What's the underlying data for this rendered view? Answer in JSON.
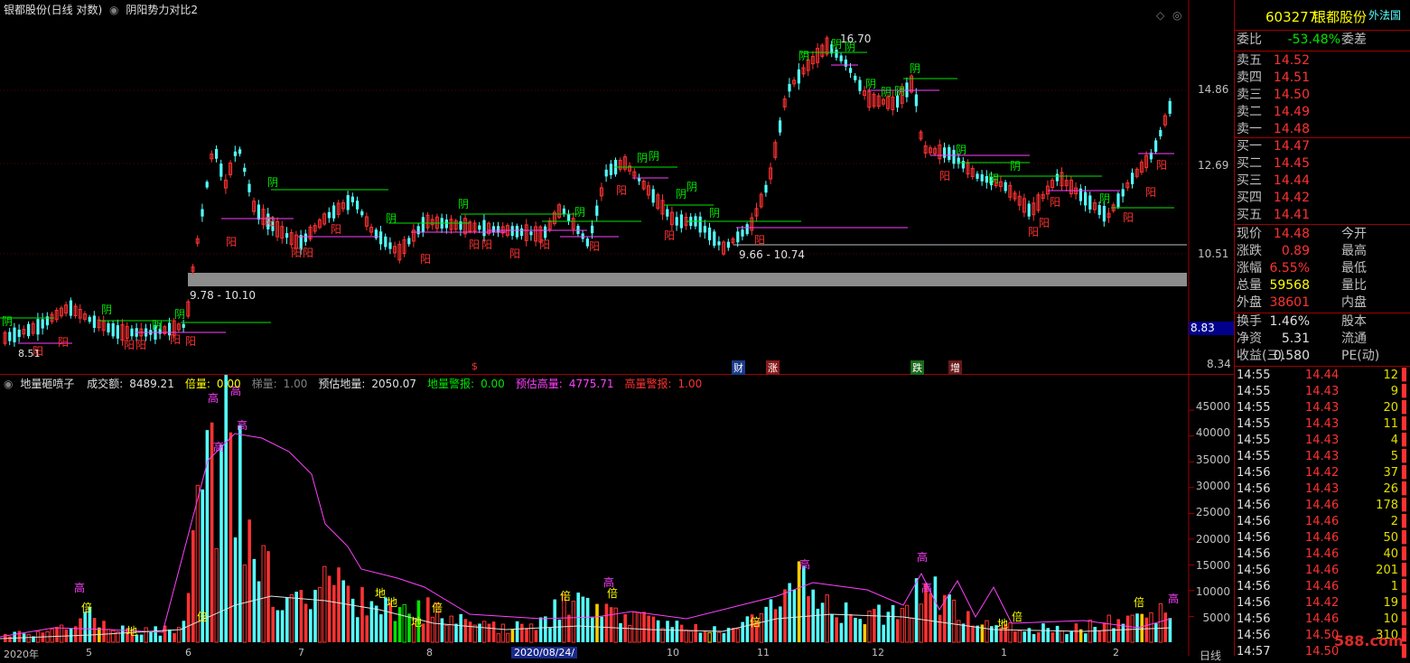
{
  "main": {
    "title": "银都股份(日线 对数)",
    "indicator": "阴阳势力对比2",
    "price_labels": [
      "14.86",
      "12.69",
      "10.51",
      "8.83",
      "8.34"
    ],
    "notes": {
      "high": "16.70",
      "low": "8.51",
      "band1": "9.78 - 10.10",
      "band2": "9.66 - 10.74"
    },
    "event_marks": [
      "$",
      "财",
      "涨",
      "跌",
      "增"
    ],
    "yin": "阴",
    "yang": "阳"
  },
  "volume": {
    "name": "地量砸喷子",
    "items": [
      {
        "label": "成交额:",
        "value": "8489.21",
        "color": "#e0e0e0"
      },
      {
        "label": "倍量:",
        "value": "0.00",
        "color": "#ffff00"
      },
      {
        "label": "梯量:",
        "value": "1.00",
        "color": "#808080"
      },
      {
        "label": "预估地量:",
        "value": "2050.07",
        "color": "#e0e0e0"
      },
      {
        "label": "地量警报:",
        "value": "0.00",
        "color": "#00e600"
      },
      {
        "label": "预估高量:",
        "value": "4775.71",
        "color": "#ff40ff"
      },
      {
        "label": "高量警报:",
        "value": "1.00",
        "color": "#ff3232"
      }
    ],
    "y_labels": [
      "45000",
      "40000",
      "35000",
      "30000",
      "25000",
      "20000",
      "15000",
      "10000",
      "5000"
    ],
    "x_labels": [
      "2020年",
      "5",
      "6",
      "7",
      "8",
      "2020/08/24/",
      "10",
      "11",
      "12",
      "1",
      "2"
    ],
    "markers": {
      "gao": "高",
      "bei": "倍",
      "di": "地"
    },
    "bottom_tab": "日线"
  },
  "quote": {
    "code": "603277",
    "name": "银都股份",
    "corner": "外法国",
    "wei_bi": {
      "label": "委比",
      "value": "-53.48%",
      "label2": "委差"
    },
    "sell": [
      {
        "label": "卖五",
        "price": "14.52"
      },
      {
        "label": "卖四",
        "price": "14.51"
      },
      {
        "label": "卖三",
        "price": "14.50"
      },
      {
        "label": "卖二",
        "price": "14.49"
      },
      {
        "label": "卖一",
        "price": "14.48"
      }
    ],
    "buy": [
      {
        "label": "买一",
        "price": "14.47"
      },
      {
        "label": "买二",
        "price": "14.45"
      },
      {
        "label": "买三",
        "price": "14.44"
      },
      {
        "label": "买四",
        "price": "14.42"
      },
      {
        "label": "买五",
        "price": "14.41"
      }
    ],
    "stats": [
      {
        "l": "现价",
        "v": "14.48",
        "l2": "今开",
        "c": "#ff3232"
      },
      {
        "l": "涨跌",
        "v": "0.89",
        "l2": "最高",
        "c": "#ff3232"
      },
      {
        "l": "涨幅",
        "v": "6.55%",
        "l2": "最低",
        "c": "#ff3232"
      },
      {
        "l": "总量",
        "v": "59568",
        "l2": "量比",
        "c": "#ffff00"
      },
      {
        "l": "外盘",
        "v": "38601",
        "l2": "内盘",
        "c": "#ff3232"
      }
    ],
    "stats2": [
      {
        "l": "换手",
        "v": "1.46%",
        "l2": "股本",
        "c": "#e0e0e0"
      },
      {
        "l": "净资",
        "v": "5.31",
        "l2": "流通",
        "c": "#e0e0e0"
      },
      {
        "l": "收益(三)",
        "v": "0.580",
        "l2": "PE(动)",
        "c": "#e0e0e0"
      }
    ],
    "ticks": [
      {
        "t": "14:55",
        "p": "14.44",
        "v": "12",
        "c": "#ff3232"
      },
      {
        "t": "14:55",
        "p": "14.43",
        "v": "9",
        "c": "#ff3232"
      },
      {
        "t": "14:55",
        "p": "14.43",
        "v": "20",
        "c": "#ff3232"
      },
      {
        "t": "14:55",
        "p": "14.43",
        "v": "11",
        "c": "#ff3232"
      },
      {
        "t": "14:55",
        "p": "14.43",
        "v": "4",
        "c": "#ff3232"
      },
      {
        "t": "14:55",
        "p": "14.43",
        "v": "5",
        "c": "#ff3232"
      },
      {
        "t": "14:56",
        "p": "14.42",
        "v": "37",
        "c": "#ff3232"
      },
      {
        "t": "14:56",
        "p": "14.43",
        "v": "26",
        "c": "#ff3232"
      },
      {
        "t": "14:56",
        "p": "14.46",
        "v": "178",
        "c": "#ff3232"
      },
      {
        "t": "14:56",
        "p": "14.46",
        "v": "2",
        "c": "#ff3232"
      },
      {
        "t": "14:56",
        "p": "14.46",
        "v": "50",
        "c": "#ff3232"
      },
      {
        "t": "14:56",
        "p": "14.46",
        "v": "40",
        "c": "#ff3232"
      },
      {
        "t": "14:56",
        "p": "14.46",
        "v": "201",
        "c": "#ff3232"
      },
      {
        "t": "14:56",
        "p": "14.46",
        "v": "1",
        "c": "#ff3232"
      },
      {
        "t": "14:56",
        "p": "14.42",
        "v": "19",
        "c": "#ff3232"
      },
      {
        "t": "14:56",
        "p": "14.46",
        "v": "10",
        "c": "#ff3232"
      },
      {
        "t": "14:56",
        "p": "14.50",
        "v": "310",
        "c": "#ff3232"
      },
      {
        "t": "14:57",
        "p": "14.50",
        "v": "",
        "c": "#ff3232"
      }
    ],
    "watermark": "588.com"
  }
}
